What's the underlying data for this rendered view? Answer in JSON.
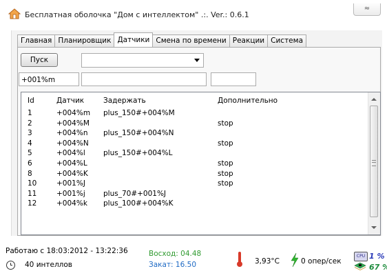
{
  "window": {
    "title": "Бесплатная оболочка \"Дом с интеллектом\" .:. Ver.: 0.6.1",
    "close_label": "≈"
  },
  "tabs": [
    {
      "label": "Главная"
    },
    {
      "label": "Планировщик"
    },
    {
      "label": "Датчики",
      "active": true
    },
    {
      "label": "Смена по времени"
    },
    {
      "label": "Реакции"
    },
    {
      "label": "Система"
    }
  ],
  "toolbar": {
    "start_label": "Пуск",
    "combo_value": ""
  },
  "fields": {
    "field1": "+001%m",
    "field2": "",
    "field3": ""
  },
  "table": {
    "headers": {
      "id": "Id",
      "sensor": "Датчик",
      "delay": "Задержать",
      "extra": "Дополнительно"
    },
    "rows": [
      {
        "id": "1",
        "sensor": "+004%m",
        "delay": "plus_150#+004%M",
        "extra": ""
      },
      {
        "id": "2",
        "sensor": "+004%M",
        "delay": "",
        "extra": "stop"
      },
      {
        "id": "3",
        "sensor": "+004%n",
        "delay": "plus_150#+004%N",
        "extra": ""
      },
      {
        "id": "4",
        "sensor": "+004%N",
        "delay": "",
        "extra": "stop"
      },
      {
        "id": "5",
        "sensor": "+004%l",
        "delay": "plus_150#+004%L",
        "extra": ""
      },
      {
        "id": "6",
        "sensor": "+004%L",
        "delay": "",
        "extra": "stop"
      },
      {
        "id": "8",
        "sensor": "+004%K",
        "delay": "",
        "extra": "stop"
      },
      {
        "id": "10",
        "sensor": "+001%J",
        "delay": "",
        "extra": "stop"
      },
      {
        "id": "11",
        "sensor": "+001%j",
        "delay": "plus_70#+001%J",
        "extra": ""
      },
      {
        "id": "12",
        "sensor": "+004%k",
        "delay": "plus_100#+004%K",
        "extra": ""
      }
    ]
  },
  "status": {
    "working": "Работаю с 18:03:2012 - 13:22:36",
    "intels": "40 интеллов",
    "sunrise": "Восход: 04.48",
    "sunset": "Закат: 16.50",
    "temperature": "3,93°C",
    "ops": "0 опер/сек",
    "cpu_label": "CPU",
    "cpu_load": "1 %",
    "mem_load": "67 %"
  },
  "colors": {
    "sunrise": "#2f9a2f",
    "sunset": "#1d69c4",
    "thermometer": "#d83a2a",
    "cpu": "#2a3ab8",
    "mem": "#1d8b3c"
  },
  "icons": [
    "house-icon",
    "clock-icon",
    "thermometer-icon",
    "lightning-icon",
    "cpu-icon",
    "memory-icon"
  ]
}
